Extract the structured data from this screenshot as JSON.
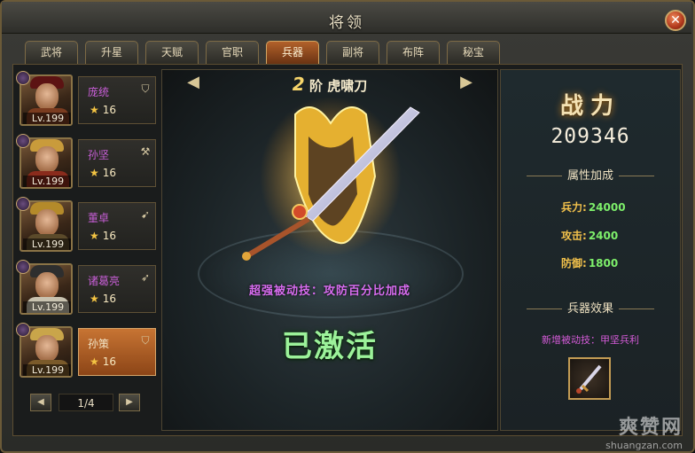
{
  "window": {
    "title": "将领",
    "close_glyph": "✕"
  },
  "tabs": [
    {
      "label": "武将",
      "active": false
    },
    {
      "label": "升星",
      "active": false
    },
    {
      "label": "天赋",
      "active": false
    },
    {
      "label": "官职",
      "active": false
    },
    {
      "label": "兵器",
      "active": true
    },
    {
      "label": "副将",
      "active": false
    },
    {
      "label": "布阵",
      "active": false
    },
    {
      "label": "秘宝",
      "active": false
    }
  ],
  "heroes": [
    {
      "name": "庞统",
      "level": "Lv.199",
      "stars": "16",
      "equip_icon": "shield-icon",
      "active": false
    },
    {
      "name": "孙坚",
      "level": "Lv.199",
      "stars": "16",
      "equip_icon": "axe-icon",
      "active": false
    },
    {
      "name": "董卓",
      "level": "Lv.199",
      "stars": "16",
      "equip_icon": "arrow-icon",
      "active": false
    },
    {
      "name": "诸葛亮",
      "level": "Lv.199",
      "stars": "16",
      "equip_icon": "bow-icon",
      "active": false
    },
    {
      "name": "孙策",
      "level": "Lv.199",
      "stars": "16",
      "equip_icon": "shield-icon",
      "active": true
    }
  ],
  "pager": {
    "text": "1/4"
  },
  "weapon": {
    "rank": "2",
    "rank_suffix": "阶",
    "name": "虎啸刀",
    "skill": "超强被动技：攻防百分比加成",
    "status": "已激活"
  },
  "power": {
    "label": "战力",
    "value": "209346"
  },
  "attributes": {
    "title": "属性加成",
    "stats": [
      {
        "label": "兵力:",
        "value": "24000"
      },
      {
        "label": "攻击:",
        "value": "2400"
      },
      {
        "label": "防御:",
        "value": "1800"
      }
    ]
  },
  "effects": {
    "title": "兵器效果",
    "text": "新增被动技：甲坚兵利"
  },
  "watermark": {
    "big": "爽赞网",
    "small": "shuangzan.com"
  },
  "colors": {
    "accent": "#b2612a",
    "skill": "#d86cf0",
    "activated": "#9cf29a",
    "stat_value": "#7ef06b"
  }
}
